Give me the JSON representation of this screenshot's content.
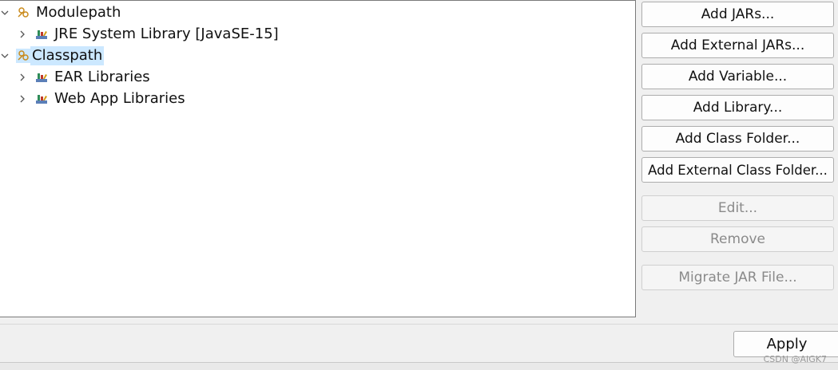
{
  "tree": {
    "modulepath": {
      "label": "Modulepath",
      "icon": "path-folder-icon",
      "children": [
        {
          "label": "JRE System Library [JavaSE-15]",
          "icon": "library-icon"
        }
      ]
    },
    "classpath": {
      "label": "Classpath",
      "icon": "path-folder-icon",
      "children": [
        {
          "label": "EAR Libraries",
          "icon": "library-icon"
        },
        {
          "label": "Web App Libraries",
          "icon": "library-icon"
        }
      ]
    }
  },
  "buttons": {
    "add_jars": "Add JARs...",
    "add_external_jars": "Add External JARs...",
    "add_variable": "Add Variable...",
    "add_library": "Add Library...",
    "add_class_folder": "Add Class Folder...",
    "add_external_class_folder": "Add External Class Folder...",
    "edit": "Edit...",
    "remove": "Remove",
    "migrate_jar": "Migrate JAR File..."
  },
  "footer": {
    "apply": "Apply",
    "watermark": "CSDN @AIGK7"
  },
  "colors": {
    "selection": "#cce8ff",
    "disabled_text": "#8a8a8a"
  }
}
